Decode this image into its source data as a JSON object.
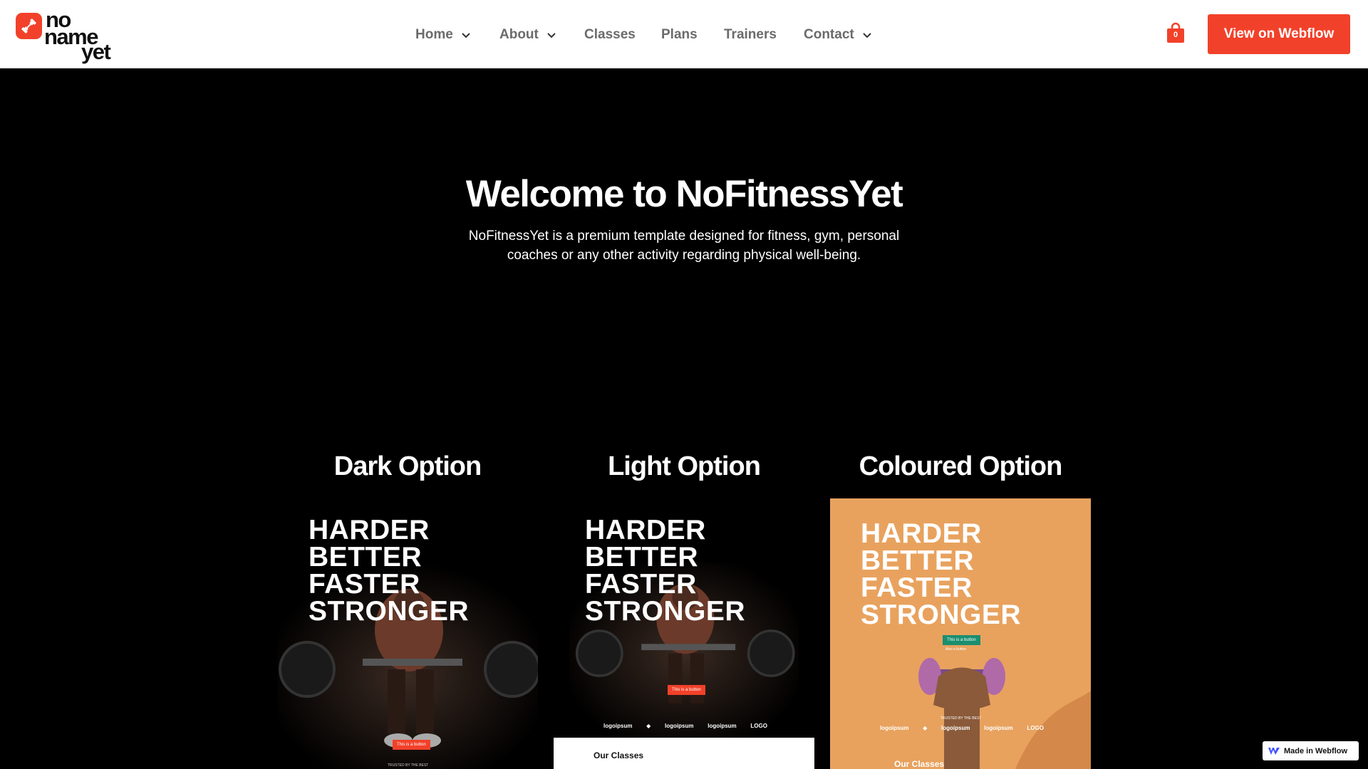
{
  "brand": {
    "logo_text": [
      "no",
      "name",
      "yet"
    ],
    "accent_color": "#f2412a"
  },
  "nav": {
    "items": [
      {
        "label": "Home",
        "has_dropdown": true
      },
      {
        "label": "About",
        "has_dropdown": true
      },
      {
        "label": "Classes",
        "has_dropdown": false
      },
      {
        "label": "Plans",
        "has_dropdown": false
      },
      {
        "label": "Trainers",
        "has_dropdown": false
      },
      {
        "label": "Contact",
        "has_dropdown": true
      }
    ],
    "cart_count": "0",
    "cta_label": "View on Webflow"
  },
  "hero": {
    "title": "Welcome to NoFitnessYet",
    "subtitle": "NoFitnessYet is a premium template designed for fitness, gym, personal coaches or any other activity regarding physical well-being."
  },
  "options": [
    {
      "title": "Dark Option",
      "headline": [
        "HARDER",
        "BETTER",
        "FASTER",
        "STRONGER"
      ],
      "button": "This is a button",
      "footer_text": "TRUSTED BY THE BEST"
    },
    {
      "title": "Light Option",
      "headline": [
        "HARDER",
        "BETTER",
        "FASTER",
        "STRONGER"
      ],
      "button": "This is a button",
      "section": "Our Classes",
      "logos": [
        "logoipsum",
        "◆",
        "logoipsum",
        "logoipsum",
        "LOGO"
      ]
    },
    {
      "title": "Coloured Option",
      "headline": [
        "HARDER",
        "BETTER",
        "FASTER",
        "STRONGER"
      ],
      "button": "This is a button",
      "link": "Also a button",
      "footer_text": "TRUSTED BY THE BEST",
      "section": "Our Classes",
      "logos": [
        "logoipsum",
        "◆",
        "logoipsum",
        "logoipsum",
        "LOGO"
      ]
    }
  ],
  "badge": {
    "label": "Made in Webflow"
  }
}
